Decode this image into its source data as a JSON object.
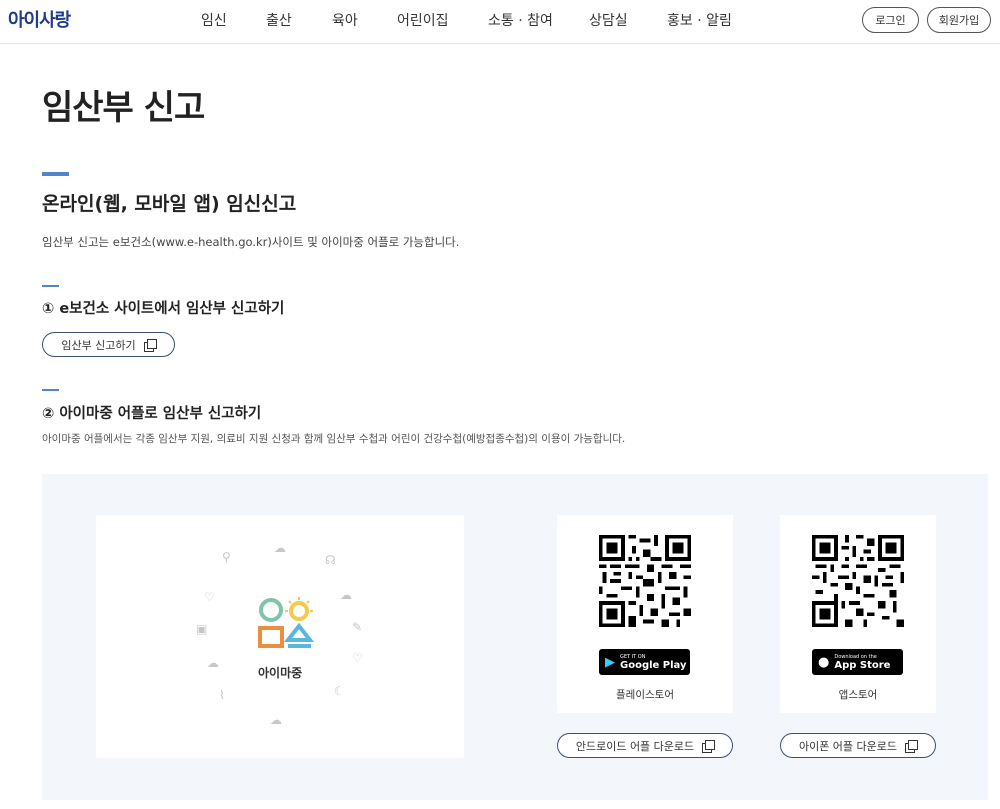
{
  "header": {
    "logo": "아이사랑",
    "nav": [
      "임신",
      "출산",
      "육아",
      "어린이집",
      "소통 · 참여",
      "상담실",
      "홍보 · 알림"
    ],
    "login": "로그인",
    "signup": "회원가입"
  },
  "page": {
    "title": "임산부 신고",
    "section_title": "온라인(웹, 모바일 앱) 임신신고",
    "section_desc": "임산부 신고는 e보건소(www.e-health.go.kr)사이트 및 아이마중 어플로 가능합니다."
  },
  "step1": {
    "title": "① e보건소 사이트에서 임산부 신고하기",
    "button": "임산부 신고하기"
  },
  "step2": {
    "title": "② 아이마중 어플로 임산부 신고하기",
    "desc": "아이마중 어플에서는 각종 임산부 지원, 의료비 지원 신청과 함께 임산부 수첩과 어린이 건강수첩(예방접종수첩)의 이용이 가능합니다."
  },
  "app": {
    "brand_name": "아이마중",
    "brand_colors": [
      "#7fc6a8",
      "#f4c94c",
      "#e8903f",
      "#59b6dc"
    ],
    "android": {
      "badge_small": "GET IT ON",
      "badge_big": "Google Play",
      "label": "플레이스토어",
      "button": "안드로이드 어플 다운로드"
    },
    "ios": {
      "badge_small": "Download on the",
      "badge_big": "App Store",
      "label": "앱스토어",
      "button": "아이폰 어플 다운로드"
    }
  },
  "colors": {
    "accent": "#4f86c6",
    "logo": "#1f3c88",
    "panel_bg": "#f3f7fc"
  }
}
